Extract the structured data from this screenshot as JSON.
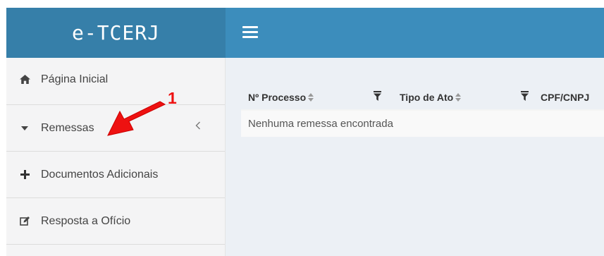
{
  "header": {
    "brand": "e-TCERJ",
    "menu_icon": "hamburger-icon"
  },
  "sidebar": {
    "items": [
      {
        "label": "Página Inicial",
        "icon": "home-icon"
      },
      {
        "label": "Remessas",
        "icon": "caret-down-icon",
        "expand_icon": "chevron-left-icon"
      },
      {
        "label": "Documentos Adicionais",
        "icon": "plus-icon"
      },
      {
        "label": "Resposta a Ofício",
        "icon": "edit-icon"
      }
    ]
  },
  "table": {
    "columns": [
      {
        "label": "Nº Processo"
      },
      {
        "label": "Tipo de Ato"
      },
      {
        "label": "CPF/CNPJ"
      }
    ],
    "empty_message": "Nenhuma remessa encontrada"
  },
  "annotation": {
    "number": "1",
    "color": "#ee1111"
  },
  "colors": {
    "header_brand": "#367fa9",
    "header_bar": "#3c8dbc",
    "sidebar_bg": "#f4f4f5",
    "content_bg": "#ecf0f5"
  }
}
